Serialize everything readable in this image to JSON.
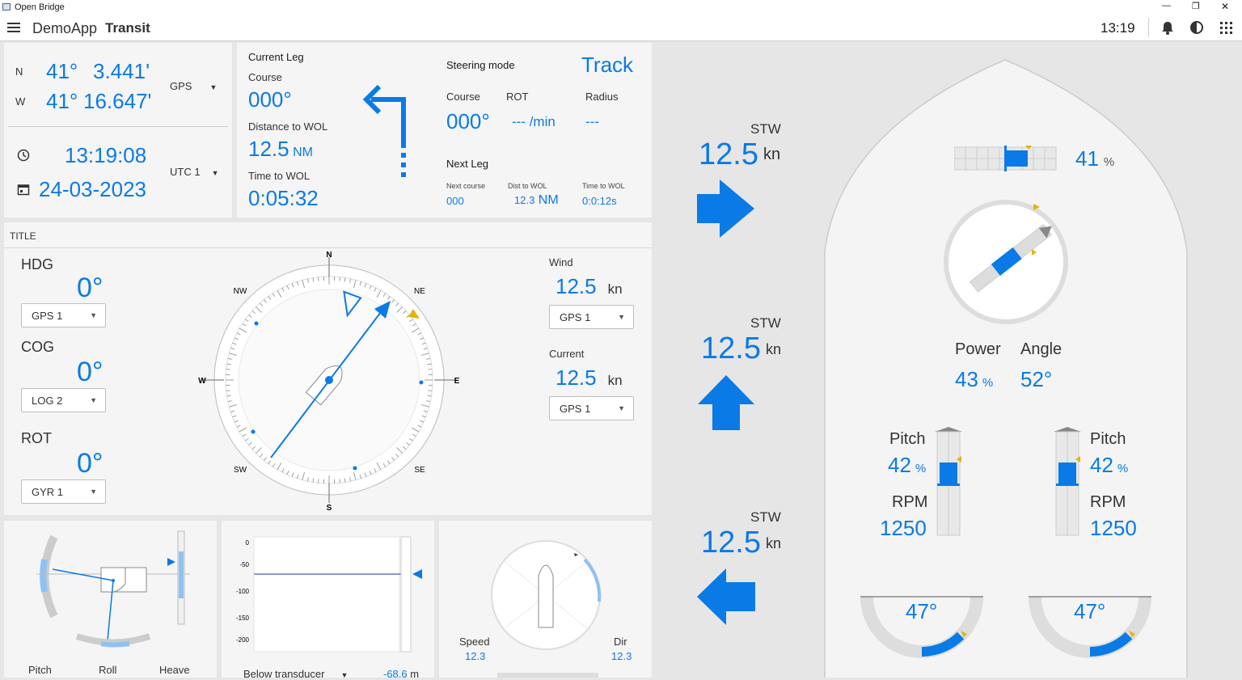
{
  "window": {
    "title": "Open Bridge",
    "controls": [
      "—",
      "❐",
      "✕"
    ]
  },
  "app": {
    "name": "DemoApp",
    "page": "Transit",
    "time": "13:19"
  },
  "position": {
    "lat_label": "N",
    "lat_deg": "41°",
    "lat_min": "3.441'",
    "lon_label": "W",
    "lon_deg": "41°",
    "lon_min": "16.647'",
    "source": "GPS",
    "clock": "13:19:08",
    "date": "24-03-2023",
    "tz": "UTC 1"
  },
  "current_leg": {
    "title": "Current Leg",
    "course_label": "Course",
    "course": "000°",
    "dist_label": "Distance to WOL",
    "dist": "12.5",
    "dist_unit": "NM",
    "time_label": "Time to WOL",
    "time": "0:05:32"
  },
  "steering": {
    "mode_label": "Steering mode",
    "mode": "Track",
    "course_label": "Course",
    "course": "000°",
    "rot_label": "ROT",
    "rot": "--- /min",
    "radius_label": "Radius",
    "radius": "---",
    "next_title": "Next Leg",
    "next_course_label": "Next course",
    "next_course": "000",
    "dist_wol_label": "Dist to WOL",
    "dist_wol": "12.3",
    "dist_wol_unit": "NM",
    "time_wol_label": "Time to WOL",
    "time_wol": "0:0:12s"
  },
  "compass_panel": {
    "title": "TITLE",
    "hdg_label": "HDG",
    "hdg": "0°",
    "hdg_src": "GPS 1",
    "cog_label": "COG",
    "cog": "0°",
    "cog_src": "LOG 2",
    "rot_label": "ROT",
    "rot": "0°",
    "rot_src": "GYR 1",
    "cardinals": {
      "n": "N",
      "ne": "NE",
      "e": "E",
      "se": "SE",
      "s": "S",
      "sw": "SW",
      "w": "W",
      "nw": "NW"
    },
    "wind_label": "Wind",
    "wind": "12.5",
    "wind_unit": "kn",
    "wind_src": "GPS 1",
    "current_label": "Current",
    "current": "12.5",
    "current_unit": "kn",
    "current_src": "GPS 1"
  },
  "motion": {
    "pitch": "Pitch",
    "roll": "Roll",
    "heave": "Heave"
  },
  "depth": {
    "ticks": [
      "0",
      "-50",
      "-100",
      "-150",
      "-200"
    ],
    "ref": "Below transducer",
    "value": "-68.6",
    "unit": "m"
  },
  "wind_dial": {
    "speed_label": "Speed",
    "speed": "12.3",
    "dir_label": "Dir",
    "dir": "12.3"
  },
  "stw": [
    {
      "label": "STW",
      "value": "12.5",
      "unit": "kn"
    },
    {
      "label": "STW",
      "value": "12.5",
      "unit": "kn"
    },
    {
      "label": "STW",
      "value": "12.5",
      "unit": "kn"
    }
  ],
  "propulsion": {
    "thruster_pct": "41",
    "thruster_unit": "%",
    "power_label": "Power",
    "power": "43",
    "power_unit": "%",
    "angle_label": "Angle",
    "angle": "52°",
    "port": {
      "pitch_label": "Pitch",
      "pitch": "42",
      "pitch_unit": "%",
      "rpm_label": "RPM",
      "rpm": "1250",
      "rudder": "47°"
    },
    "stbd": {
      "pitch_label": "Pitch",
      "pitch": "42",
      "pitch_unit": "%",
      "rpm_label": "RPM",
      "rpm": "1250",
      "rudder": "47°"
    }
  }
}
